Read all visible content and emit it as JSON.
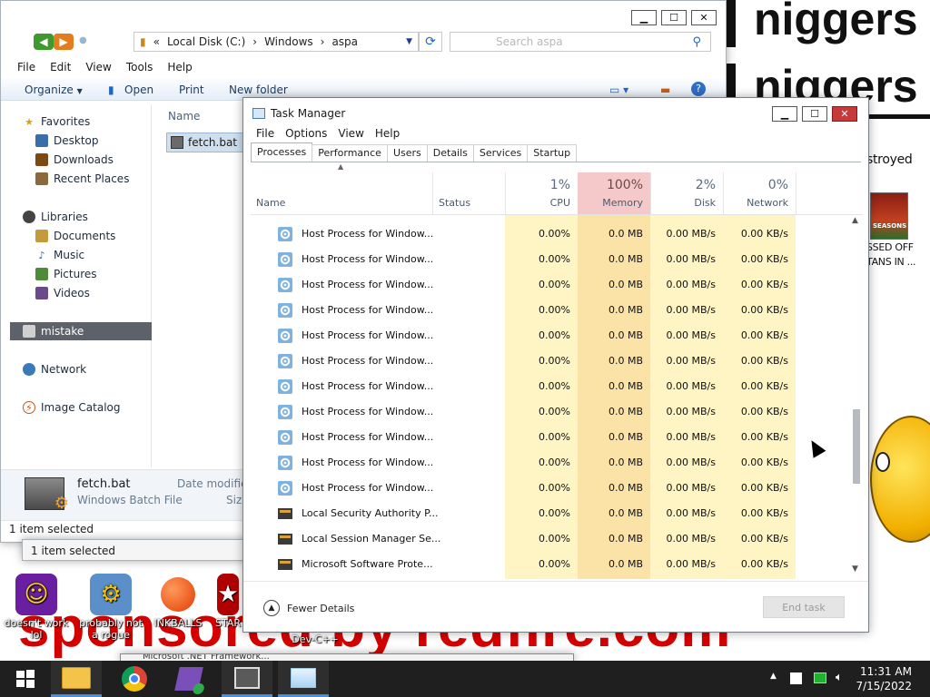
{
  "desktop": {
    "wall_lines": [
      "niggers",
      "niggers"
    ],
    "wall_bottom": "sponsored by redfire.com",
    "game_caption_top": "stroyed",
    "game_caption_1": "SSED OFF",
    "game_caption_2": "TANS IN ...",
    "game_thumb_label": "SEASONS",
    "icons": [
      {
        "label": "doesn't work lol"
      },
      {
        "label": "probably not a rogue"
      },
      {
        "label": "INKBALLS"
      },
      {
        "label": "STAR"
      }
    ],
    "devcpp_label": "Dev-C++",
    "ghost_title": "Microsoft .NET Framework..."
  },
  "explorer": {
    "address_parts": [
      "Local Disk (C:)",
      "Windows",
      "aspa"
    ],
    "search_placeholder": "Search aspa",
    "menu": [
      "File",
      "Edit",
      "View",
      "Tools",
      "Help"
    ],
    "toolbar": {
      "organize": "Organize",
      "open": "Open",
      "print": "Print",
      "new_folder": "New folder"
    },
    "sidebar": {
      "favorites": "Favorites",
      "desktop": "Desktop",
      "downloads": "Downloads",
      "recent": "Recent Places",
      "libraries": "Libraries",
      "documents": "Documents",
      "music": "Music",
      "pictures": "Pictures",
      "videos": "Videos",
      "selected": "mistake",
      "network": "Network",
      "image_catalog": "Image Catalog"
    },
    "column_name": "Name",
    "file_name": "fetch.bat",
    "details": {
      "name": "fetch.bat",
      "type": "Windows Batch File",
      "date_label": "Date modified",
      "size_label": "Size"
    },
    "status": "1 item selected",
    "status_behind": "1 item selected"
  },
  "taskmgr": {
    "title": "Task Manager",
    "menu": [
      "File",
      "Options",
      "View",
      "Help"
    ],
    "tabs": [
      "Processes",
      "Performance",
      "Users",
      "Details",
      "Services",
      "Startup"
    ],
    "columns": {
      "name": "Name",
      "status": "Status",
      "cpu_pct": "1%",
      "cpu": "CPU",
      "mem_pct": "100%",
      "mem": "Memory",
      "disk_pct": "2%",
      "disk": "Disk",
      "net_pct": "0%",
      "net": "Network"
    },
    "rows": [
      {
        "name": "Host Process for Window...",
        "cpu": "0.00%",
        "mem": "0.0 MB",
        "disk": "0.00 MB/s",
        "net": "0.00 KB/s"
      },
      {
        "name": "Host Process for Window...",
        "cpu": "0.00%",
        "mem": "0.0 MB",
        "disk": "0.00 MB/s",
        "net": "0.00 KB/s"
      },
      {
        "name": "Host Process for Window...",
        "cpu": "0.00%",
        "mem": "0.0 MB",
        "disk": "0.00 MB/s",
        "net": "0.00 KB/s"
      },
      {
        "name": "Host Process for Window...",
        "cpu": "0.00%",
        "mem": "0.0 MB",
        "disk": "0.00 MB/s",
        "net": "0.00 KB/s"
      },
      {
        "name": "Host Process for Window...",
        "cpu": "0.00%",
        "mem": "0.0 MB",
        "disk": "0.00 MB/s",
        "net": "0.00 KB/s"
      },
      {
        "name": "Host Process for Window...",
        "cpu": "0.00%",
        "mem": "0.0 MB",
        "disk": "0.00 MB/s",
        "net": "0.00 KB/s"
      },
      {
        "name": "Host Process for Window...",
        "cpu": "0.00%",
        "mem": "0.0 MB",
        "disk": "0.00 MB/s",
        "net": "0.00 KB/s"
      },
      {
        "name": "Host Process for Window...",
        "cpu": "0.00%",
        "mem": "0.0 MB",
        "disk": "0.00 MB/s",
        "net": "0.00 KB/s"
      },
      {
        "name": "Host Process for Window...",
        "cpu": "0.00%",
        "mem": "0.0 MB",
        "disk": "0.00 MB/s",
        "net": "0.00 KB/s"
      },
      {
        "name": "Host Process for Window...",
        "cpu": "0.00%",
        "mem": "0.0 MB",
        "disk": "0.00 MB/s",
        "net": "0.00 KB/s"
      },
      {
        "name": "Host Process for Window...",
        "cpu": "0.00%",
        "mem": "0.0 MB",
        "disk": "0.00 MB/s",
        "net": "0.00 KB/s"
      },
      {
        "name": "Local Security Authority P...",
        "cpu": "0.00%",
        "mem": "0.0 MB",
        "disk": "0.00 MB/s",
        "net": "0.00 KB/s"
      },
      {
        "name": "Local Session Manager Se...",
        "cpu": "0.00%",
        "mem": "0.0 MB",
        "disk": "0.00 MB/s",
        "net": "0.00 KB/s"
      },
      {
        "name": "Microsoft Software Prote...",
        "cpu": "0.00%",
        "mem": "0.0 MB",
        "disk": "0.00 MB/s",
        "net": "0.00 KB/s"
      }
    ],
    "footer": {
      "fewer": "Fewer Details",
      "end_task": "End task"
    }
  },
  "taskbar": {
    "clock_time": "11:31 AM",
    "clock_date": "7/15/2022"
  },
  "colors": {
    "memory_highlight": "#f5c9c9",
    "heat": "#fff4c4",
    "accent": "#1f64c8"
  }
}
